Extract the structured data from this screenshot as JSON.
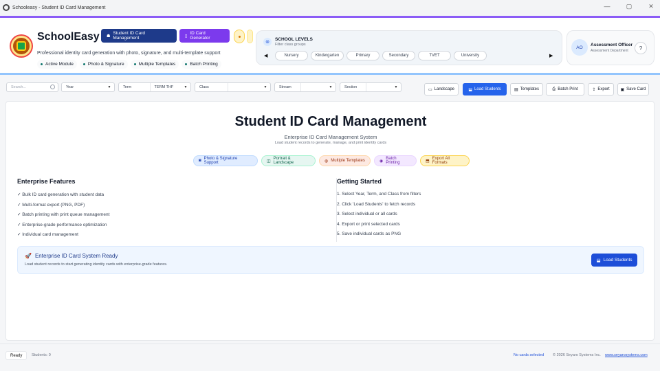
{
  "window": {
    "title": "Schooleasy - Student ID Card Management",
    "controls": [
      "—",
      "▢",
      "✕"
    ]
  },
  "header": {
    "brand": "SchoolEasy",
    "tagline": "Professional identity card generation with photo, signature, and multi-template support",
    "badges": [
      "Active Module",
      "Photo & Signature",
      "Multiple Templates",
      "Batch Printing"
    ],
    "buttons": {
      "id_management": "Student ID Card Management",
      "id_generator": "ID Card Generator"
    },
    "levels": {
      "title": "SCHOOL LEVELS",
      "subtitle": "Filter class groups",
      "items": [
        "Nursery",
        "Kindergarten",
        "Primary",
        "Secondary",
        "TVET",
        "University"
      ]
    },
    "user": {
      "initials": "AO",
      "name": "Assessment Officer",
      "department": "Assessment Department",
      "help": "?"
    }
  },
  "filters": {
    "search_placeholder": "Search...",
    "year_label": "Year",
    "year_value": "",
    "term_label": "Term",
    "term_value": "TERM THF",
    "class_label": "Class",
    "class_value": "",
    "stream_label": "Stream",
    "stream_value": "",
    "section_label": "Section",
    "section_value": ""
  },
  "toolbar": {
    "landscape": "Landscape",
    "load_students": "Load Students",
    "templates": "Templates",
    "batch_print": "Batch Print",
    "export": "Export",
    "save_card": "Save Card"
  },
  "main": {
    "title": "Student ID Card Management",
    "subtitle": "Enterprise ID Card Management System",
    "description": "Load student records to generate, manage, and print identity cards",
    "feature_pills": [
      "Photo & Signature Support",
      "Portrait & Landscape",
      "Multiple Templates",
      "Batch Printing",
      "Export All Formats"
    ],
    "features_title": "Enterprise Features",
    "features": [
      "✓ Bulk ID card generation with student data",
      "✓ Multi-format export (PNG, PDF)",
      "✓ Batch printing with print queue management",
      "✓ Enterprise-grade performance optimization",
      "✓ Individual card management"
    ],
    "getting_started_title": "Getting Started",
    "steps": [
      "1. Select Year, Term, and Class from filters",
      "2. Click 'Load Students' to fetch records",
      "3. Select individual or all cards",
      "4. Export or print selected cards",
      "5. Save individual cards as PNG"
    ],
    "ready": {
      "title": "Enterprise ID Card System Ready",
      "subtitle": "Load student records to start generating identity cards with enterprise-grade features.",
      "button": "Load Students"
    }
  },
  "footer": {
    "status": "Ready",
    "students": "Students: 0",
    "no_cards": "No cards selected",
    "copyright": "© 2026 Seyaro Systems Inc.",
    "site": "www.seyarosystems.com"
  }
}
